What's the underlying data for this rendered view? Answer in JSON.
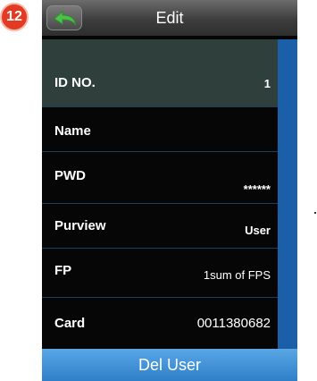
{
  "badge": {
    "step": "12"
  },
  "header": {
    "title": "Edit",
    "back_icon": "back-arrow-icon",
    "back_color": "#4cc24a"
  },
  "fields": {
    "id": {
      "label": "ID NO.",
      "value": "1"
    },
    "name": {
      "label": "Name",
      "value": ""
    },
    "pwd": {
      "label": "PWD",
      "value": "******"
    },
    "purview": {
      "label": "Purview",
      "value": "User"
    },
    "fp": {
      "label": "FP",
      "value": "1sum of FPS"
    },
    "card": {
      "label": "Card",
      "value": "0011380682"
    }
  },
  "footer": {
    "del_label": "Del User"
  },
  "colors": {
    "screen_bg": "#060606",
    "selected_row": "#2f3f3c",
    "divider": "#1d3f5c",
    "scrollbar": "#1a5fa8",
    "button_top": "#5aa7e6",
    "button_bottom": "#2f7fc9",
    "badge": "#e23a23"
  }
}
